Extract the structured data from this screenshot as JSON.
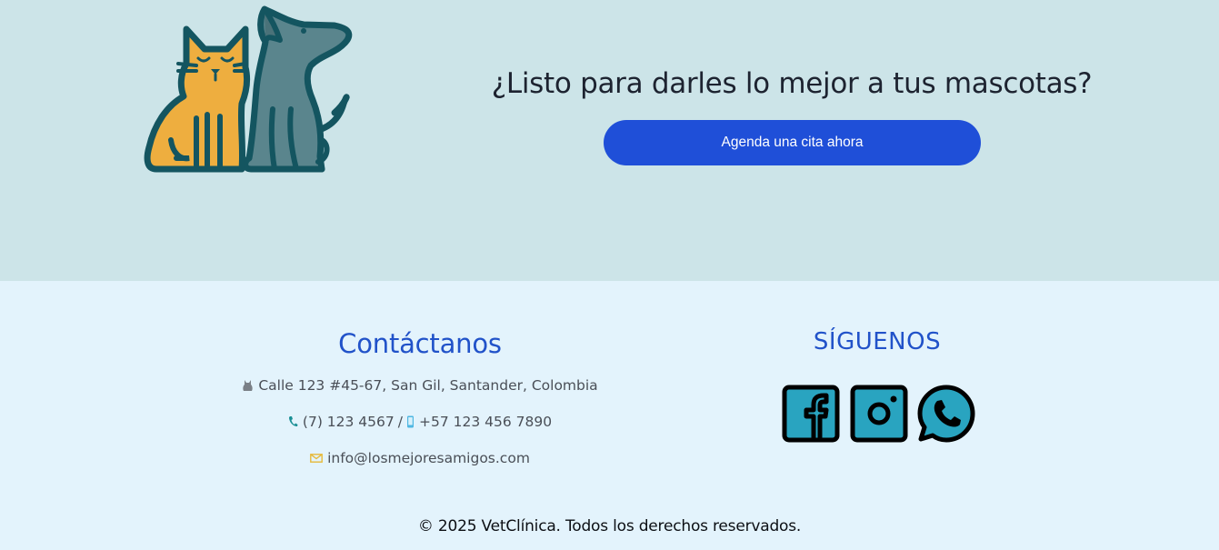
{
  "cta": {
    "title": "¿Listo para darles lo mejor a tus mascotas?",
    "button_label": "Agenda una cita ahora",
    "illustration_icon": "cat-and-dog-illustration",
    "colors": {
      "band_background": "#cce4e8",
      "button": "#1f4fd8",
      "cat": "#eeae3f",
      "dog": "#5a858d",
      "outline": "#145560"
    }
  },
  "contact": {
    "title": "Contáctanos",
    "address": "Calle 123 #45-67, San Gil, Santander, Colombia",
    "address_icon": "cat-icon",
    "phone": "(7) 123 4567",
    "phone_icon": "phone-icon",
    "separator": "/",
    "mobile": "+57 123 456 7890",
    "mobile_icon": "mobile-phone-icon",
    "email": "info@losmejoresamigos.com",
    "email_icon": "envelope-icon"
  },
  "social": {
    "title": "SÍGUENOS",
    "icons": [
      "facebook-icon",
      "instagram-icon",
      "whatsapp-icon"
    ],
    "icon_fill": "#29a4c0"
  },
  "footer": {
    "copyright": "© 2025 VetClínica. Todos los derechos reservados.",
    "background": "#e3f3fc"
  }
}
